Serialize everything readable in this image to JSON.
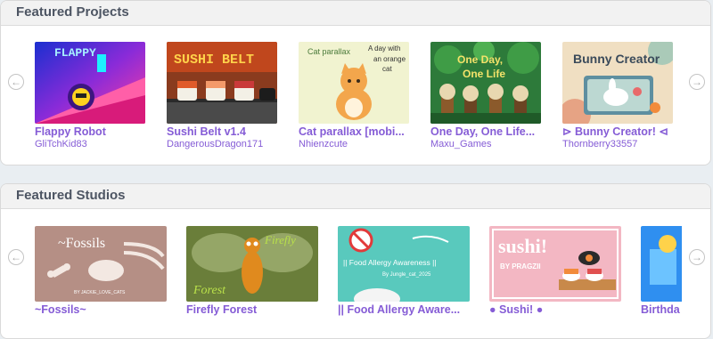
{
  "projects": {
    "title": "Featured Projects",
    "items": [
      {
        "title": "Flappy Robot",
        "author": "GliTchKid83"
      },
      {
        "title": "Sushi Belt v1.4",
        "author": "DangerousDragon171"
      },
      {
        "title": "Cat parallax [mobi...",
        "author": "Nhienzcute"
      },
      {
        "title": "One Day, One Life...",
        "author": "Maxu_Games"
      },
      {
        "title": "⊳ Bunny Creator! ⊲",
        "author": "Thornberry33557"
      }
    ]
  },
  "studios": {
    "title": "Featured Studios",
    "items": [
      {
        "title": "~Fossils~"
      },
      {
        "title": "Firefly Forest"
      },
      {
        "title": "|| Food Allergy Aware..."
      },
      {
        "title": "● Sushi! ●"
      },
      {
        "title": "Birthda"
      }
    ]
  },
  "thumb_text": {
    "flappy": "FLAPPY",
    "sushi_belt": "SUSHI BELT",
    "cat1": "Cat parallax",
    "cat2": "A day with",
    "cat3": "an orange",
    "cat4": "cat",
    "oneday1": "One Day,",
    "oneday2": "One Life",
    "bunny": "Bunny Creator",
    "fossils": "~Fossils",
    "fossils_by": "BY JACKIE_LOVE_CATS",
    "firefly1": "Firefly",
    "firefly2": "Forest",
    "allergy": "|| Food Allergy Awareness ||",
    "allergy_by": "By Jungle_cat_2025",
    "sushi_studio": "sushi!",
    "sushi_by": "BY PRAGZII"
  },
  "nav": {
    "prev_glyph": "←",
    "next_glyph": "→"
  },
  "colors": {
    "accent": "#855cd6",
    "header_text": "#4d5563"
  }
}
